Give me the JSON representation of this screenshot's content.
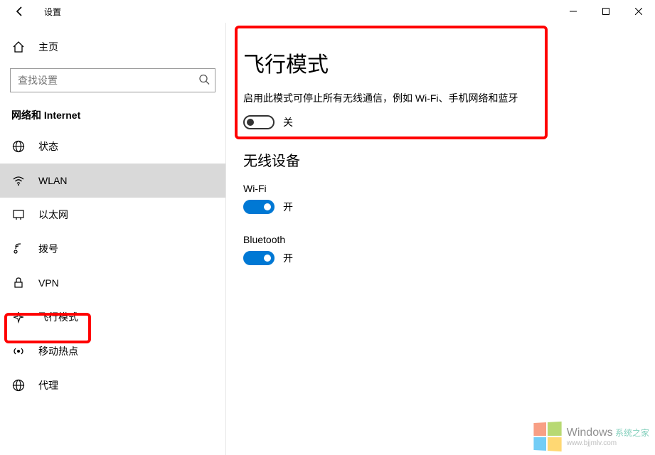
{
  "titlebar": {
    "title": "设置"
  },
  "sidebar": {
    "home": "主页",
    "search_placeholder": "查找设置",
    "category": "网络和 Internet",
    "items": [
      {
        "label": "状态"
      },
      {
        "label": "WLAN"
      },
      {
        "label": "以太网"
      },
      {
        "label": "拨号"
      },
      {
        "label": "VPN"
      },
      {
        "label": "飞行模式"
      },
      {
        "label": "移动热点"
      },
      {
        "label": "代理"
      }
    ]
  },
  "main": {
    "heading": "飞行模式",
    "desc": "启用此模式可停止所有无线通信，例如 Wi-Fi、手机网络和蓝牙",
    "airplane_state": "关",
    "wireless_heading": "无线设备",
    "wifi_label": "Wi-Fi",
    "wifi_state": "开",
    "bt_label": "Bluetooth",
    "bt_state": "开"
  },
  "watermark": {
    "brand": "Windows",
    "sub": "系统之家",
    "url": "www.bjjmlv.com"
  }
}
